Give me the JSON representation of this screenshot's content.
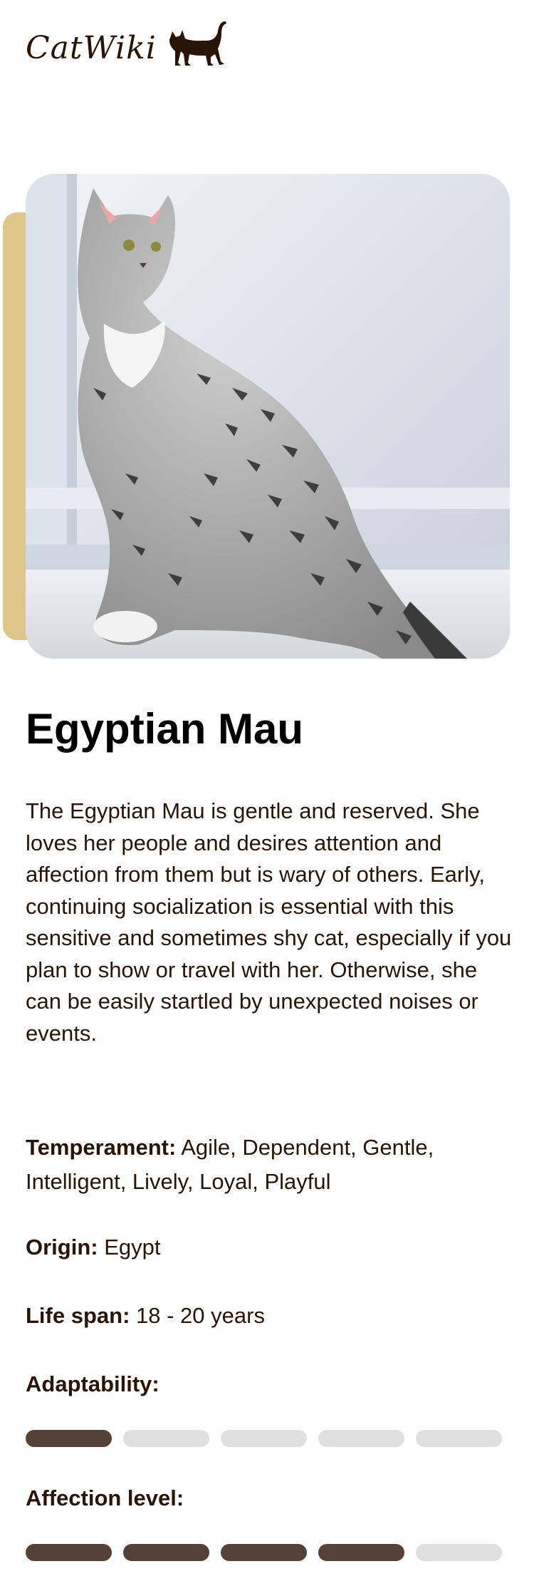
{
  "header": {
    "logo_text": "CatWiki",
    "logo_icon": "cat-silhouette-icon"
  },
  "breed": {
    "name": "Egyptian Mau",
    "image_alt": "Egyptian Mau cat sitting by a window",
    "description": "The Egyptian Mau is gentle and reserved. She loves her people and desires attention and affection from them but is wary of others. Early, continuing socialization is essential with this sensitive and sometimes shy cat, especially if you plan to show or travel with her. Otherwise, she can be easily startled by unexpected noises or events.",
    "temperament": {
      "label": "Temperament:",
      "value": "Agile, Dependent, Gentle, Intelligent, Lively, Loyal, Playful"
    },
    "origin": {
      "label": "Origin:",
      "value": "Egypt"
    },
    "life_span": {
      "label": "Life span:",
      "value": "18 - 20 years"
    },
    "adaptability": {
      "label": "Adaptability:",
      "level": 1,
      "max": 5
    },
    "affection_level": {
      "label": "Affection level:",
      "level": 4,
      "max": 5
    }
  },
  "colors": {
    "text": "#291507",
    "accent_bar": "#dec68b",
    "meter_on": "#544238",
    "meter_off": "#e0e0e0"
  }
}
